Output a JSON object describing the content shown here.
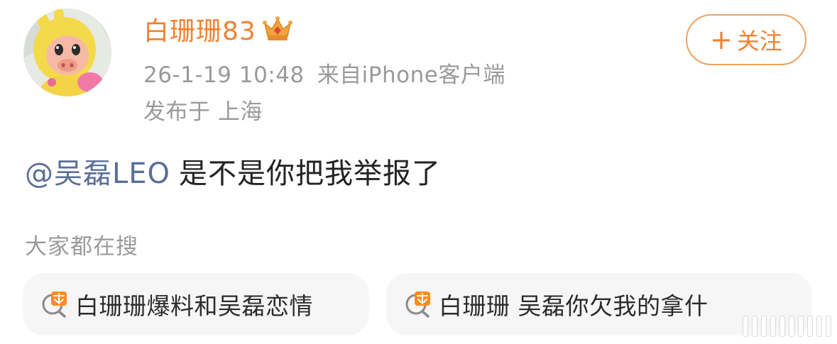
{
  "post": {
    "author": {
      "name": "白珊珊83",
      "badge_icon": "crown-icon"
    },
    "timestamp": "26-1-19 10:48",
    "source": "来自iPhone客户端",
    "location": "发布于 上海",
    "follow_button": {
      "plus": "+",
      "label": "关注"
    },
    "mention": "@吴磊LEO",
    "body": "是不是你把我举报了"
  },
  "search_suggestions": {
    "section_label": "大家都在搜",
    "items": [
      {
        "label": "白珊珊爆料和吴磊恋情",
        "icon": "hot-search-icon"
      },
      {
        "label": "白珊珊 吴磊你欠我的拿什",
        "icon": "hot-search-icon"
      }
    ]
  },
  "colors": {
    "username": "#f08132",
    "follow_border": "#f0a160",
    "mention": "#5a6f98",
    "meta_text": "#9a9a9a",
    "body_text": "#222222",
    "chip_bg": "#f6f6f6"
  }
}
